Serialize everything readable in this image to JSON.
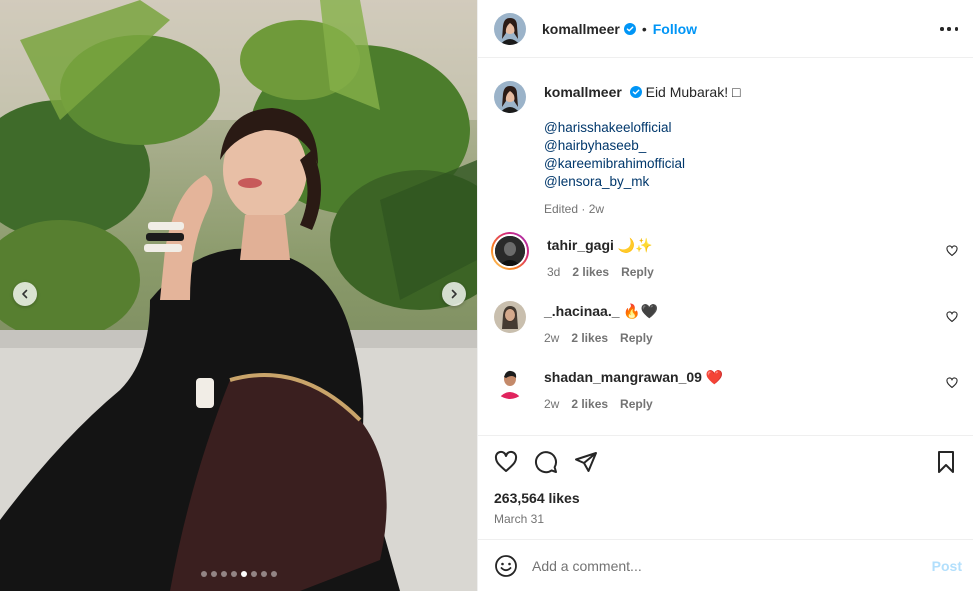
{
  "post": {
    "username": "komallmeer",
    "follow_label": "Follow",
    "caption": {
      "text": "Eid Mubarak! □",
      "mentions": [
        "@harisshakeelofficial",
        "@hairbyhaseeb_",
        "@kareemibrahimofficial",
        "@lensora_by_mk"
      ],
      "edited": "Edited",
      "age": "2w"
    },
    "comments": [
      {
        "username": "tahir_gagi",
        "text": "🌙✨",
        "age": "3d",
        "likes": "2 likes",
        "reply": "Reply"
      },
      {
        "username": "_.hacinaa._",
        "text": "🔥🖤",
        "age": "2w",
        "likes": "2 likes",
        "reply": "Reply"
      },
      {
        "username": "shadan_mangrawan_09",
        "text": "❤️",
        "age": "2w",
        "likes": "2 likes",
        "reply": "Reply"
      }
    ],
    "likes_count": "263,564 likes",
    "date": "March 31",
    "add_comment_placeholder": "Add a comment...",
    "post_label": "Post"
  },
  "carousel": {
    "slide_count": 8,
    "active_index": 4
  },
  "colors": {
    "accent": "#0095f6",
    "mention": "#00376b",
    "muted": "#737373",
    "heart_red": "#ed4956"
  }
}
